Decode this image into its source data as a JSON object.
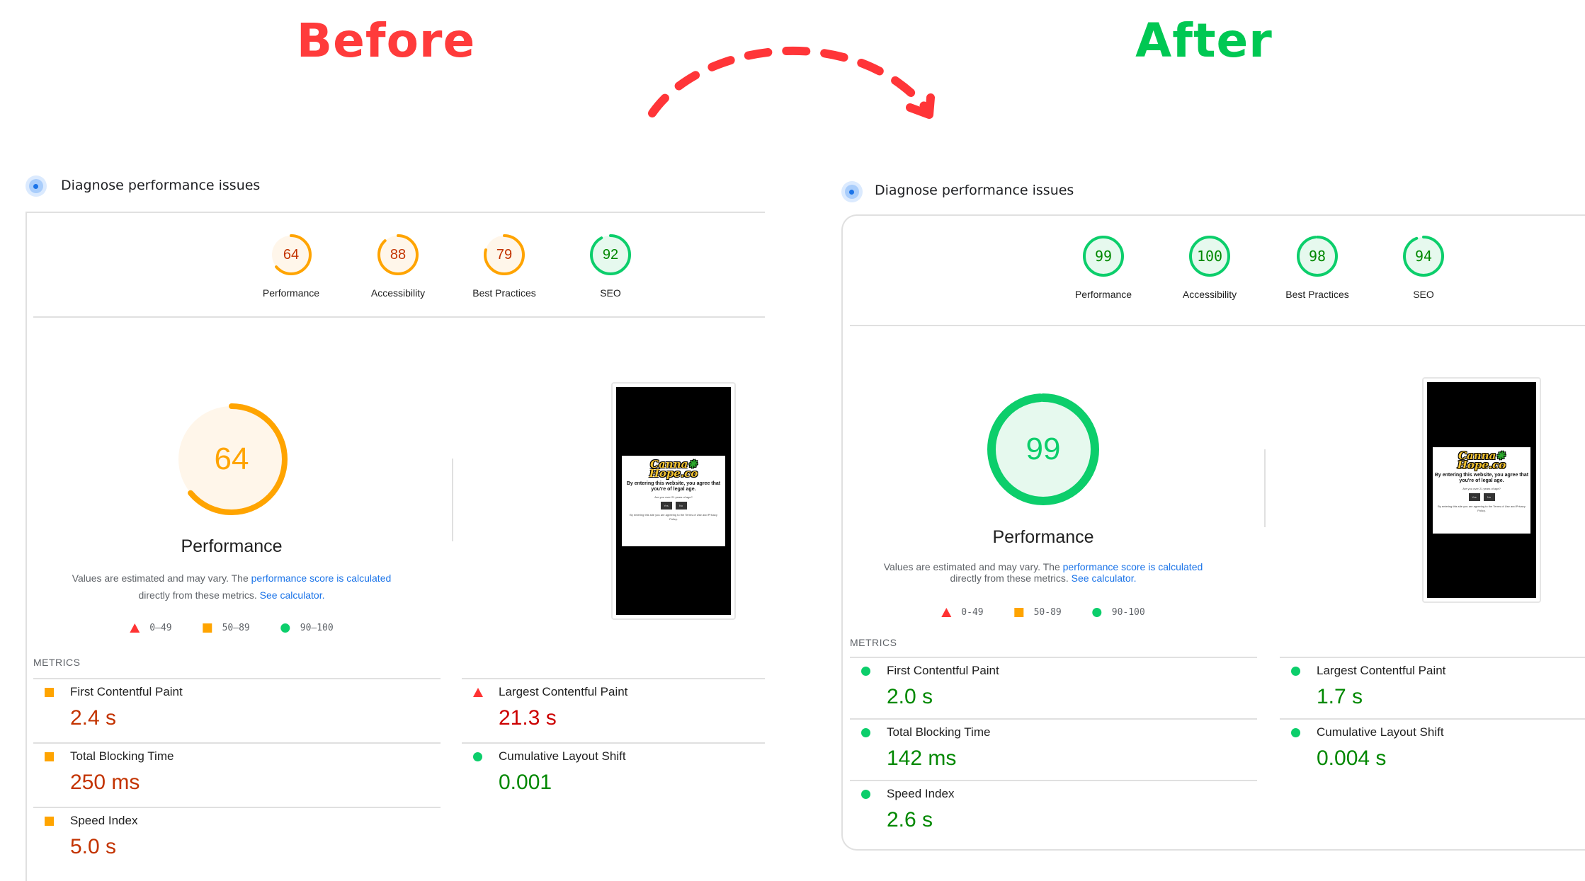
{
  "colors": {
    "fail": "#ff3333",
    "average": "#ffa400",
    "pass": "#0cce6b",
    "fail_text": "#cc0000",
    "average_text": "#c33300",
    "pass_text": "#008800",
    "link": "#1a73e8",
    "before_heading": "#ff3b3b",
    "after_heading": "#00c853"
  },
  "arrow": {
    "description": "dashed curved arrow from Before to After"
  },
  "panels": {
    "before": {
      "heading": "Before",
      "section_title": "Diagnose performance issues",
      "scores": [
        {
          "label": "Performance",
          "value": 64,
          "rating": "average"
        },
        {
          "label": "Accessibility",
          "value": 88,
          "rating": "average"
        },
        {
          "label": "Best Practices",
          "value": 79,
          "rating": "average"
        },
        {
          "label": "SEO",
          "value": 92,
          "rating": "pass"
        }
      ],
      "main_gauge": {
        "label": "Performance",
        "value": 64,
        "rating": "average"
      },
      "description": {
        "prefix": "Values are estimated and may vary. The ",
        "link1": "performance score is calculated",
        "middle": "directly from these metrics. ",
        "link2": "See calculator."
      },
      "legend": [
        {
          "shape": "triangle",
          "range": "0–49"
        },
        {
          "shape": "square",
          "range": "50–89"
        },
        {
          "shape": "circle",
          "range": "90–100"
        }
      ],
      "metrics_header": "METRICS",
      "metrics": [
        {
          "name": "First Contentful Paint",
          "value": "2.4 s",
          "rating": "average"
        },
        {
          "name": "Largest Contentful Paint",
          "value": "21.3 s",
          "rating": "fail"
        },
        {
          "name": "Total Blocking Time",
          "value": "250 ms",
          "rating": "average"
        },
        {
          "name": "Cumulative Layout Shift",
          "value": "0.001",
          "rating": "pass"
        },
        {
          "name": "Speed Index",
          "value": "5.0 s",
          "rating": "average"
        }
      ],
      "thumbnail": {
        "logo_line1": "Canna",
        "logo_line2": "Hope.co",
        "message": "By entering this website, you agree that you're of legal age.",
        "question": "Are you over 21 years of age?",
        "yes": "Yes",
        "no": "No",
        "fine_print": "By entering this site you are agreeing to the Terms of Use and Privacy Policy."
      }
    },
    "after": {
      "heading": "After",
      "section_title": "Diagnose performance issues",
      "scores": [
        {
          "label": "Performance",
          "value": 99,
          "rating": "pass"
        },
        {
          "label": "Accessibility",
          "value": 100,
          "rating": "pass"
        },
        {
          "label": "Best Practices",
          "value": 98,
          "rating": "pass"
        },
        {
          "label": "SEO",
          "value": 94,
          "rating": "pass"
        }
      ],
      "main_gauge": {
        "label": "Performance",
        "value": 99,
        "rating": "pass"
      },
      "description": {
        "prefix": "Values are estimated and may vary. The ",
        "link1": "performance score is calculated",
        "middle": "directly from these metrics. ",
        "link2": "See calculator."
      },
      "legend": [
        {
          "shape": "triangle",
          "range": "0-49"
        },
        {
          "shape": "square",
          "range": "50-89"
        },
        {
          "shape": "circle",
          "range": "90-100"
        }
      ],
      "metrics_header": "METRICS",
      "metrics": [
        {
          "name": "First Contentful Paint",
          "value": "2.0 s",
          "rating": "pass"
        },
        {
          "name": "Largest Contentful Paint",
          "value": "1.7 s",
          "rating": "pass"
        },
        {
          "name": "Total Blocking Time",
          "value": "142 ms",
          "rating": "pass"
        },
        {
          "name": "Cumulative Layout Shift",
          "value": "0.004 s",
          "rating": "pass"
        },
        {
          "name": "Speed Index",
          "value": "2.6 s",
          "rating": "pass"
        }
      ],
      "thumbnail": {
        "logo_line1": "Canna",
        "logo_line2": "Hope.co",
        "message": "By entering this website, you agree that you're of legal age.",
        "question": "Are you over 21 years of age?",
        "yes": "Yes",
        "no": "No",
        "fine_print": "By entering this site you are agreeing to the Terms of Use and Privacy Policy."
      }
    }
  }
}
